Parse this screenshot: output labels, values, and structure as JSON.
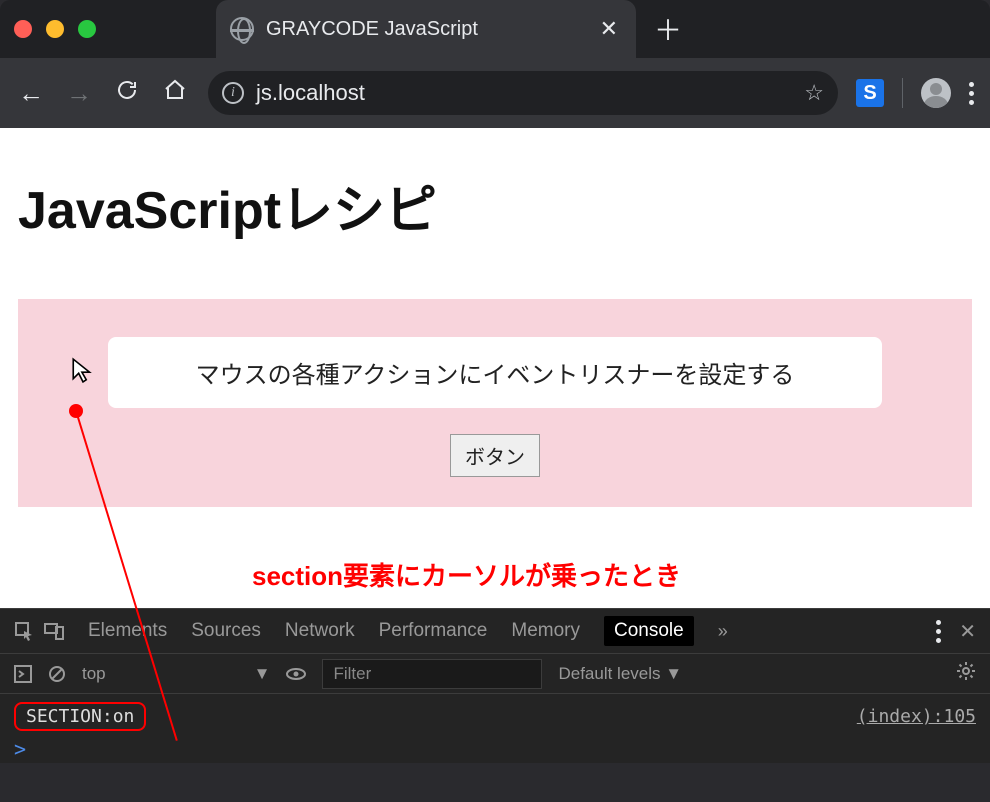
{
  "window": {
    "tab_title": "GRAYCODE JavaScript",
    "url": "js.localhost"
  },
  "page": {
    "heading": "JavaScriptレシピ",
    "card_text": "マウスの各種アクションにイベントリスナーを設定する",
    "button_label": "ボタン"
  },
  "annotation": {
    "text": "section要素にカーソルが乗ったとき"
  },
  "devtools": {
    "tabs": {
      "elements": "Elements",
      "sources": "Sources",
      "network": "Network",
      "performance": "Performance",
      "memory": "Memory",
      "console": "Console",
      "more": "»"
    },
    "context": "top",
    "filter_placeholder": "Filter",
    "levels": "Default levels ▼",
    "log_message": "SECTION:on",
    "log_source": "(index):105",
    "prompt": ">"
  }
}
